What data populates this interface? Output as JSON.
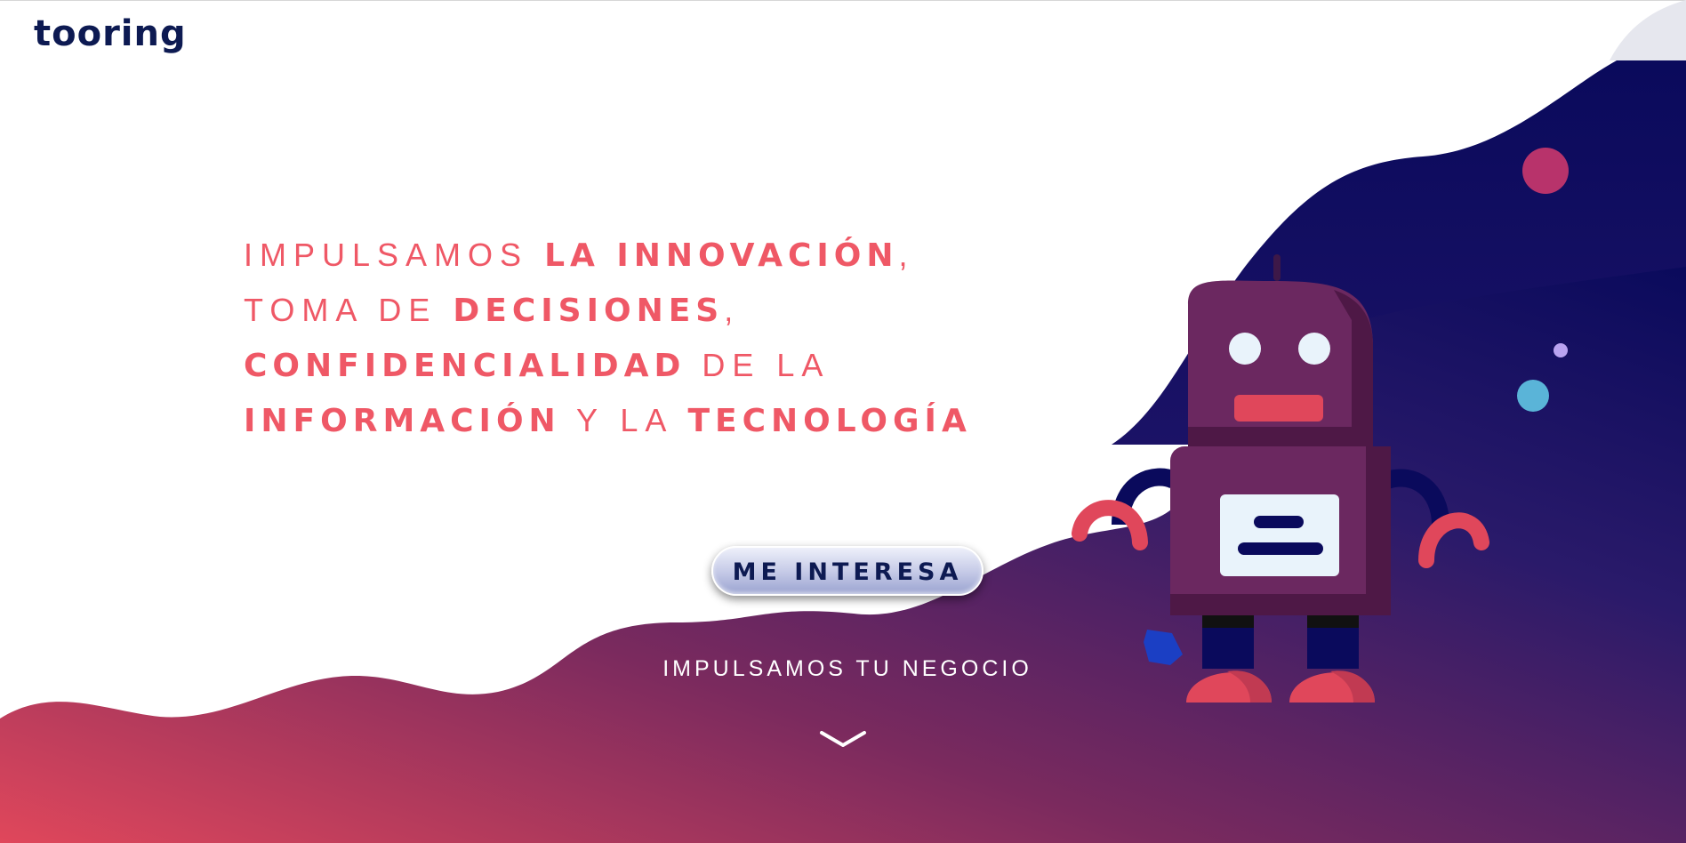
{
  "brand": {
    "logo_text": "tooring",
    "accent": "#e0475b",
    "navy": "#0d1a52"
  },
  "hero": {
    "line1": {
      "light": "IMPULSAMOS ",
      "bold": "LA INNOVACIÓN",
      "tail": ","
    },
    "line2": {
      "light": "TOMA DE ",
      "bold": "DECISIONES",
      "tail": ","
    },
    "line3": {
      "bold": "CONFIDENCIALIDAD",
      "light": " DE LA"
    },
    "line4": {
      "bold1": "INFORMACIÓN",
      "light": " Y LA ",
      "bold2": "TECNOLOGÍA"
    },
    "text_color": "#ef5866"
  },
  "cta": {
    "label": "ME INTERESA"
  },
  "tagline": "IMPULSAMOS TU NEGOCIO",
  "scroll_indicator": {
    "icon": "chevron-down-icon"
  },
  "illustration": {
    "subject": "robot",
    "planet_colors": [
      "#b8336b",
      "#5ab4d8",
      "#b9a3f0"
    ]
  },
  "colors": {
    "wave_start": "#e0475b",
    "wave_mid": "#7a2a5e",
    "wave_end": "#0a0a5c",
    "page_bg": "#ffffff"
  }
}
